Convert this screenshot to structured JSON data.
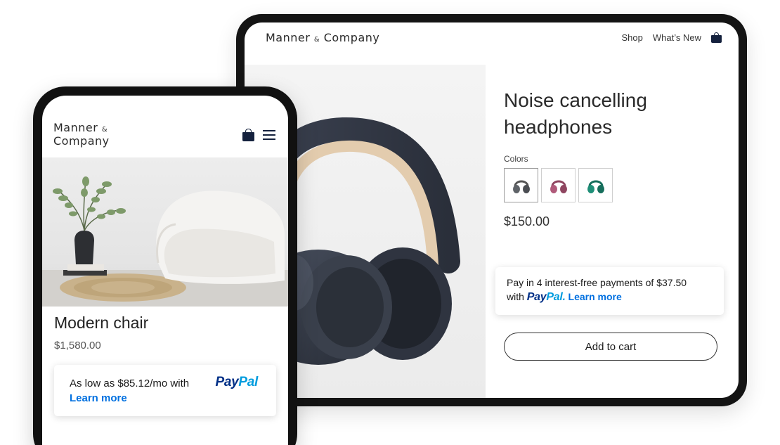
{
  "tablet": {
    "brand": {
      "first": "Manner",
      "amp": "&",
      "second": "Company"
    },
    "nav": {
      "shop": "Shop",
      "whats_new": "What’s New"
    },
    "product": {
      "title": "Noise cancelling headphones",
      "colors_label": "Colors",
      "swatches": [
        {
          "name": "Grey",
          "color": "#5f6368"
        },
        {
          "name": "Pink",
          "color": "#b05a7a"
        },
        {
          "name": "Teal",
          "color": "#1f8f78"
        }
      ],
      "price": "$150.00"
    },
    "paypal": {
      "text": "Pay in 4 interest-free payments of $37.50",
      "with": "with",
      "logo_pay": "Pay",
      "logo_pal": "Pal.",
      "learn_more": "Learn more"
    },
    "add_to_cart": "Add to cart"
  },
  "phone": {
    "brand": {
      "first": "Manner",
      "amp": "&",
      "second": "Company"
    },
    "product": {
      "title": "Modern chair",
      "price": "$1,580.00"
    },
    "paypal": {
      "text": "As low as $85.12/mo with",
      "logo_pay": "Pay",
      "logo_pal": "Pal",
      "learn_more": "Learn more"
    }
  },
  "colors": {
    "paypal_dark": "#003087",
    "paypal_light": "#009cde",
    "link_blue": "#0070e0",
    "navy": "#14213d"
  }
}
